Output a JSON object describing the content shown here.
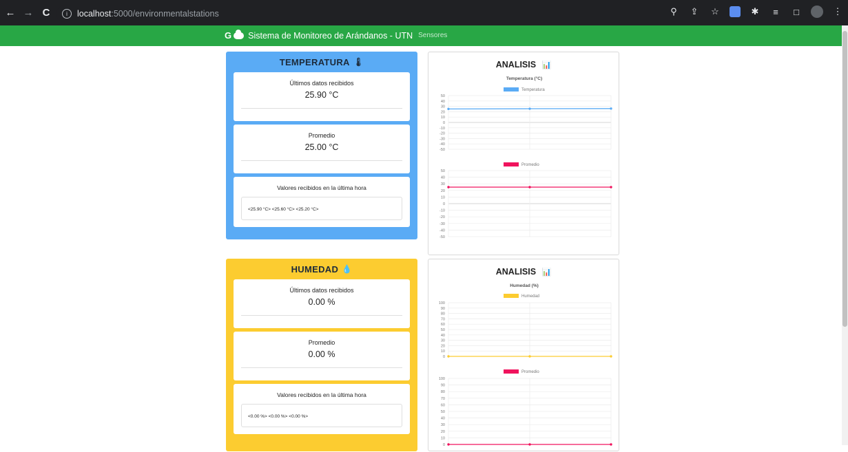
{
  "browser": {
    "url_host": "localhost",
    "url_path": ":5000/environmentalstations"
  },
  "navbar": {
    "logo": "G",
    "title": "Sistema de Monitoreo de Arándanos - UTN",
    "link": "Sensores"
  },
  "colors": {
    "navbar": "#28a745",
    "temperature_panel": "#5aabf5",
    "humidity_panel": "#fccc30",
    "temperature_line": "#5aabf5",
    "average_line": "#f0135d",
    "humidity_line": "#fccc30"
  },
  "temperature": {
    "title": "TEMPERATURA",
    "icon": "thermometer-icon",
    "latest_label": "Últimos datos recibidos",
    "latest_value": "25.90 °C",
    "average_label": "Promedio",
    "average_value": "25.00 °C",
    "hour_label": "Valores recibidos en la última hora",
    "hour_values": "<25.90 °C> <25.60 °C> <25.20 °C>"
  },
  "humidity": {
    "title": "HUMEDAD",
    "icon": "droplet-icon",
    "latest_label": "Últimos datos recibidos",
    "latest_value": "0.00 %",
    "average_label": "Promedio",
    "average_value": "0.00 %",
    "hour_label": "Valores recibidos en la última hora",
    "hour_values": "<0.00 %> <0.00 %> <0.00 %>"
  },
  "analysis": {
    "title": "ANALISIS",
    "icon": "bar-chart-icon"
  },
  "chart_data": [
    {
      "type": "line",
      "title": "Temperatura (°C)",
      "series": [
        {
          "name": "Temperatura",
          "values": [
            25.2,
            25.6,
            25.9
          ]
        }
      ],
      "x": [
        1,
        2,
        3
      ],
      "ylim": [
        -50,
        50
      ],
      "yticks": [
        50,
        40,
        30,
        20,
        10,
        0,
        -10,
        -20,
        -30,
        -40,
        -50
      ],
      "grid": true,
      "legend": "top"
    },
    {
      "type": "line",
      "title": "",
      "series": [
        {
          "name": "Promedio",
          "values": [
            25,
            25,
            25
          ]
        }
      ],
      "x": [
        1,
        2,
        3
      ],
      "ylim": [
        -50,
        50
      ],
      "yticks": [
        50,
        40,
        30,
        20,
        10,
        0,
        -10,
        -20,
        -30,
        -40,
        -50
      ],
      "grid": true,
      "legend": "top"
    },
    {
      "type": "line",
      "title": "Humedad (%)",
      "series": [
        {
          "name": "Humedad",
          "values": [
            0,
            0,
            0
          ]
        }
      ],
      "x": [
        1,
        2,
        3
      ],
      "ylim": [
        0,
        100
      ],
      "yticks": [
        100,
        90,
        80,
        70,
        60,
        50,
        40,
        30,
        20,
        10,
        0
      ],
      "grid": true,
      "legend": "top"
    },
    {
      "type": "line",
      "title": "",
      "series": [
        {
          "name": "Promedio",
          "values": [
            0,
            0,
            0
          ]
        }
      ],
      "x": [
        1,
        2,
        3
      ],
      "ylim": [
        0,
        100
      ],
      "yticks": [
        100,
        90,
        80,
        70,
        60,
        50,
        40,
        30,
        20,
        10,
        0
      ],
      "grid": true,
      "legend": "top"
    }
  ]
}
